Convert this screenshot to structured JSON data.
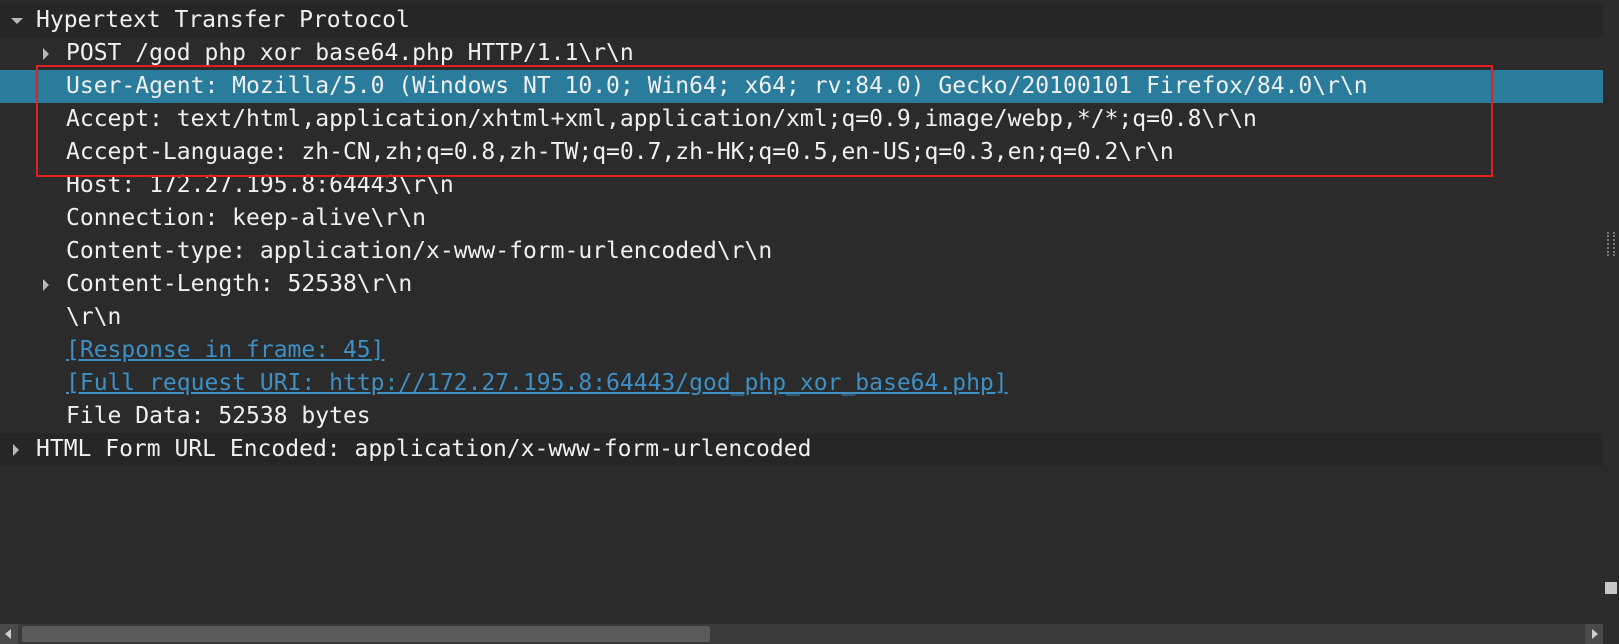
{
  "tree": {
    "http_header": "Hypertext Transfer Protocol",
    "request_line": "POST /god php xor base64.php HTTP/1.1\\r\\n",
    "user_agent": "User-Agent: Mozilla/5.0 (Windows NT 10.0; Win64; x64; rv:84.0) Gecko/20100101 Firefox/84.0\\r\\n",
    "accept": "Accept: text/html,application/xhtml+xml,application/xml;q=0.9,image/webp,*/*;q=0.8\\r\\n",
    "accept_language": "Accept-Language: zh-CN,zh;q=0.8,zh-TW;q=0.7,zh-HK;q=0.5,en-US;q=0.3,en;q=0.2\\r\\n",
    "host": "Host: 172.27.195.8:64443\\r\\n",
    "connection": "Connection: keep-alive\\r\\n",
    "content_type": "Content-type: application/x-www-form-urlencoded\\r\\n",
    "content_length": "Content-Length: 52538\\r\\n",
    "crlf": "\\r\\n",
    "response_in_frame": "[Response in frame: 45]",
    "full_request_uri": "[Full request URI: http://172.27.195.8:64443/god_php_xor_base64.php]",
    "file_data": "File Data: 52538 bytes",
    "form_encoded": "HTML Form URL Encoded: application/x-www-form-urlencoded"
  },
  "colors": {
    "background": "#2b2b2b",
    "selected_row": "#2a7c9c",
    "link": "#3d8fc4",
    "highlight_box": "#e02020"
  },
  "icons": {
    "expanded": "triangle-down-icon",
    "collapsed": "triangle-right-icon"
  }
}
